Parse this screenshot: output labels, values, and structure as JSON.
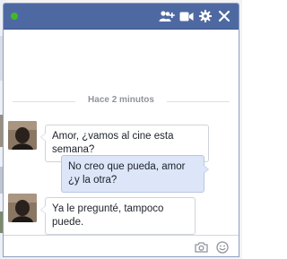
{
  "chat": {
    "title": "",
    "online": true,
    "icons": {
      "add_friend": "add-friends-icon",
      "video": "video-call-icon",
      "settings": "gear-icon",
      "close": "close-icon"
    }
  },
  "messages": {
    "timestamp": "Hace 2 minutos",
    "items": [
      {
        "direction": "incoming",
        "text": "Amor, ¿vamos al cine esta semana?"
      },
      {
        "direction": "outgoing",
        "text": "No creo que pueda, amor ¿y la otra?"
      },
      {
        "direction": "incoming",
        "text": "Ya le pregunté, tampoco puede."
      }
    ]
  },
  "composer": {
    "placeholder": "",
    "icons": {
      "photo": "camera-icon",
      "emoji": "emoji-icon"
    }
  },
  "colors": {
    "titlebar": "#4e69a2",
    "online_dot": "#42b72a",
    "outgoing_bubble": "#dce6f8",
    "incoming_bubble": "#ffffff"
  }
}
